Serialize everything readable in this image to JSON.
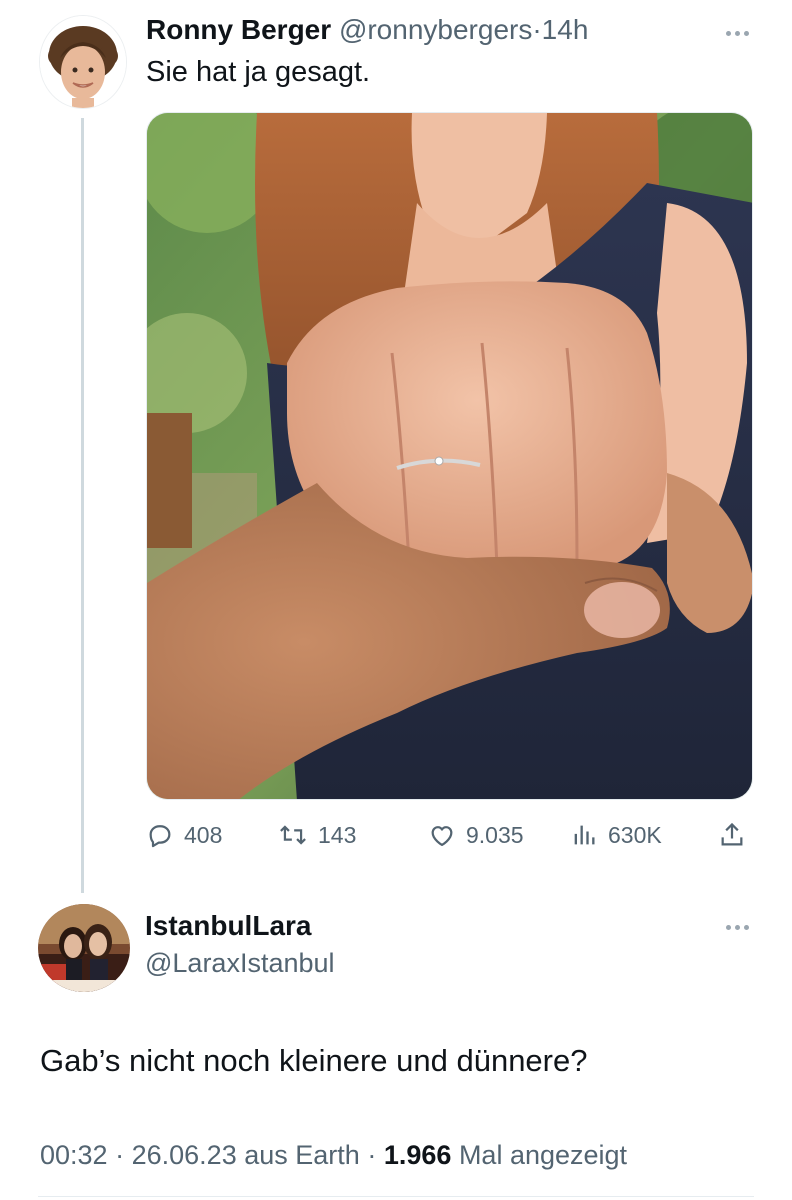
{
  "tweet": {
    "author_name": "Ronny Berger",
    "author_handle": "@ronnybergers",
    "separator": "·",
    "time": "14h",
    "text": "Sie hat ja gesagt.",
    "media_description_icon": "photo",
    "actions": {
      "replies": "408",
      "retweets": "143",
      "likes": "9.035",
      "views": "630K"
    }
  },
  "reply": {
    "author_name": "IstanbulLara",
    "author_handle": "@LaraxIstanbul",
    "text": "Gab’s nicht noch kleinere und dünnere?",
    "time": "00:32",
    "sep1": "·",
    "date": "26.06.23",
    "source": "aus Earth",
    "sep2": "·",
    "view_count": "1.966",
    "view_suffix": "Mal angezeigt"
  },
  "colors": {
    "text": "#0f1419",
    "secondary": "#536471",
    "line": "#cfd9de"
  },
  "icons": [
    "more-icon",
    "reply-icon",
    "retweet-icon",
    "like-icon",
    "views-icon",
    "share-icon"
  ]
}
